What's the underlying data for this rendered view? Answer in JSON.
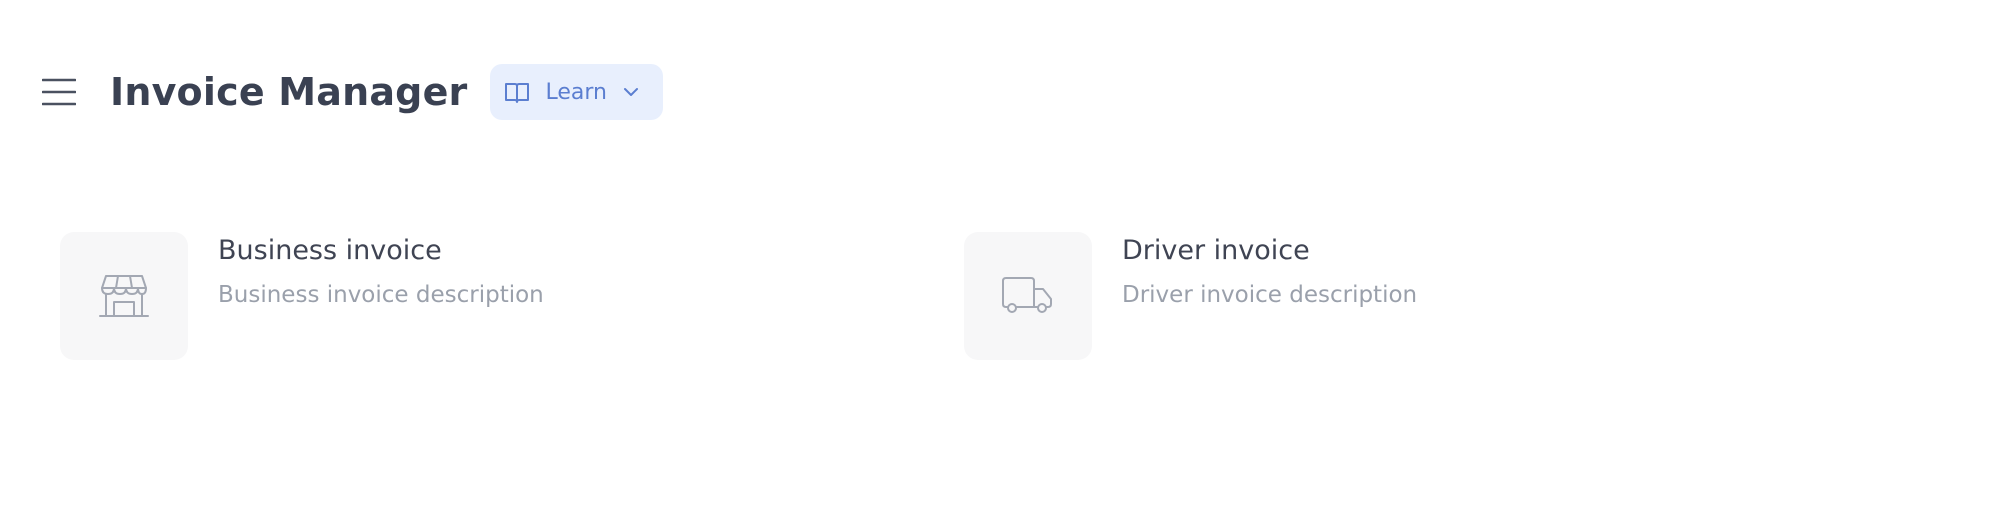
{
  "header": {
    "title": "Invoice Manager",
    "learn_label": "Learn",
    "menu_icon": "hamburger-menu-icon",
    "learn_icon": "book-icon",
    "learn_chevron": "chevron-down-icon"
  },
  "cards": [
    {
      "title": "Business invoice",
      "description": "Business invoice description",
      "icon": "storefront-icon"
    },
    {
      "title": "Driver invoice",
      "description": "Driver invoice description",
      "icon": "truck-icon"
    }
  ],
  "colors": {
    "title": "#3a4152",
    "learn_bg": "#e8effd",
    "learn_text": "#5b7ed0",
    "card_icon_bg": "#f7f7f8",
    "icon_stroke": "#a3a8b3",
    "desc_text": "#9aa0ab"
  }
}
